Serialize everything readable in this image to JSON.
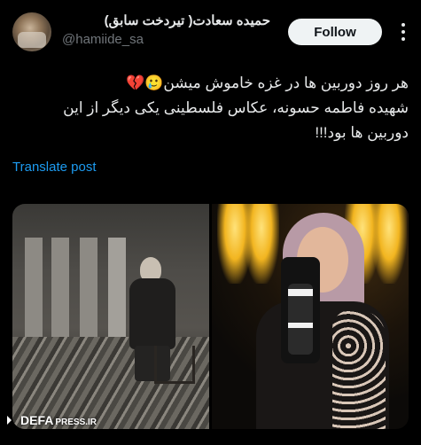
{
  "post": {
    "author": {
      "display_name": "حمیده سعادت( تیردخت سابق)",
      "handle": "@hamiide_sa"
    },
    "follow_label": "Follow",
    "text_lines": [
      "هر روز دوربین ها در غزه خاموش میشن🥲💔",
      "شهیده فاطمه حسونه، عکاس فلسطینی یکی دیگر از این",
      "دوربین ها بود!!!"
    ],
    "translate_label": "Translate post"
  },
  "watermark": {
    "main": "DEFA",
    "sub": "PRESS.IR"
  },
  "colors": {
    "background": "#000000",
    "link": "#1d9bf0",
    "follow_bg": "#eff3f4"
  },
  "icons": [
    "more-options-icon",
    "defa-press-logo-icon"
  ]
}
